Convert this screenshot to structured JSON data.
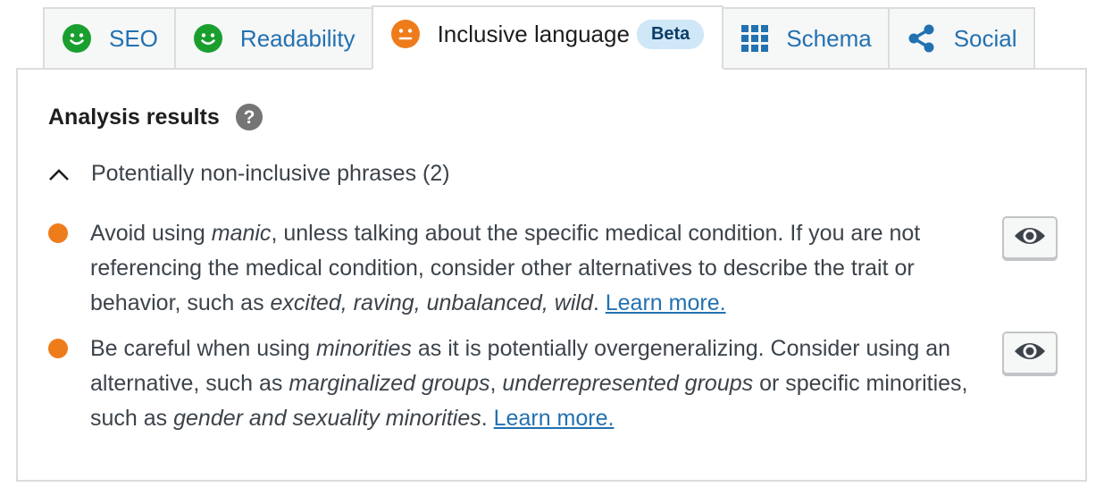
{
  "tabs": [
    {
      "label": "SEO",
      "icon": "smiley-good-icon",
      "status_color": "#1a9f2e"
    },
    {
      "label": "Readability",
      "icon": "smiley-good-icon",
      "status_color": "#1a9f2e"
    },
    {
      "label": "Inclusive language",
      "icon": "smiley-neutral-icon",
      "status_color": "#ee7c1b",
      "badge": "Beta",
      "active": true
    },
    {
      "label": "Schema",
      "icon": "grid-icon"
    },
    {
      "label": "Social",
      "icon": "share-icon"
    }
  ],
  "panel": {
    "heading": "Analysis results",
    "group_label": "Potentially non-inclusive phrases (2)",
    "results": [
      {
        "status_color": "#ee7c1b",
        "segments": [
          {
            "t": "Avoid using "
          },
          {
            "t": "manic",
            "em": true
          },
          {
            "t": ", unless talking about the specific medical condition. If you are not referencing the medical condition, consider other alternatives to describe the trait or behavior, such as "
          },
          {
            "t": "excited, raving, unbalanced, wild",
            "em": true
          },
          {
            "t": ". "
          },
          {
            "t": "Learn more.",
            "link": true
          }
        ]
      },
      {
        "status_color": "#ee7c1b",
        "segments": [
          {
            "t": "Be careful when using "
          },
          {
            "t": "minorities",
            "em": true
          },
          {
            "t": " as it is potentially overgeneralizing. Consider using an alternative, such as "
          },
          {
            "t": "marginalized groups",
            "em": true
          },
          {
            "t": ", "
          },
          {
            "t": "underrepresented groups",
            "em": true
          },
          {
            "t": " or specific minorities, such as "
          },
          {
            "t": "gender and sexuality minorities",
            "em": true
          },
          {
            "t": ". "
          },
          {
            "t": "Learn more.",
            "link": true
          }
        ]
      }
    ]
  },
  "colors": {
    "link": "#2271b1",
    "good": "#1a9f2e",
    "warning": "#ee7c1b",
    "border": "#dcdcde"
  }
}
